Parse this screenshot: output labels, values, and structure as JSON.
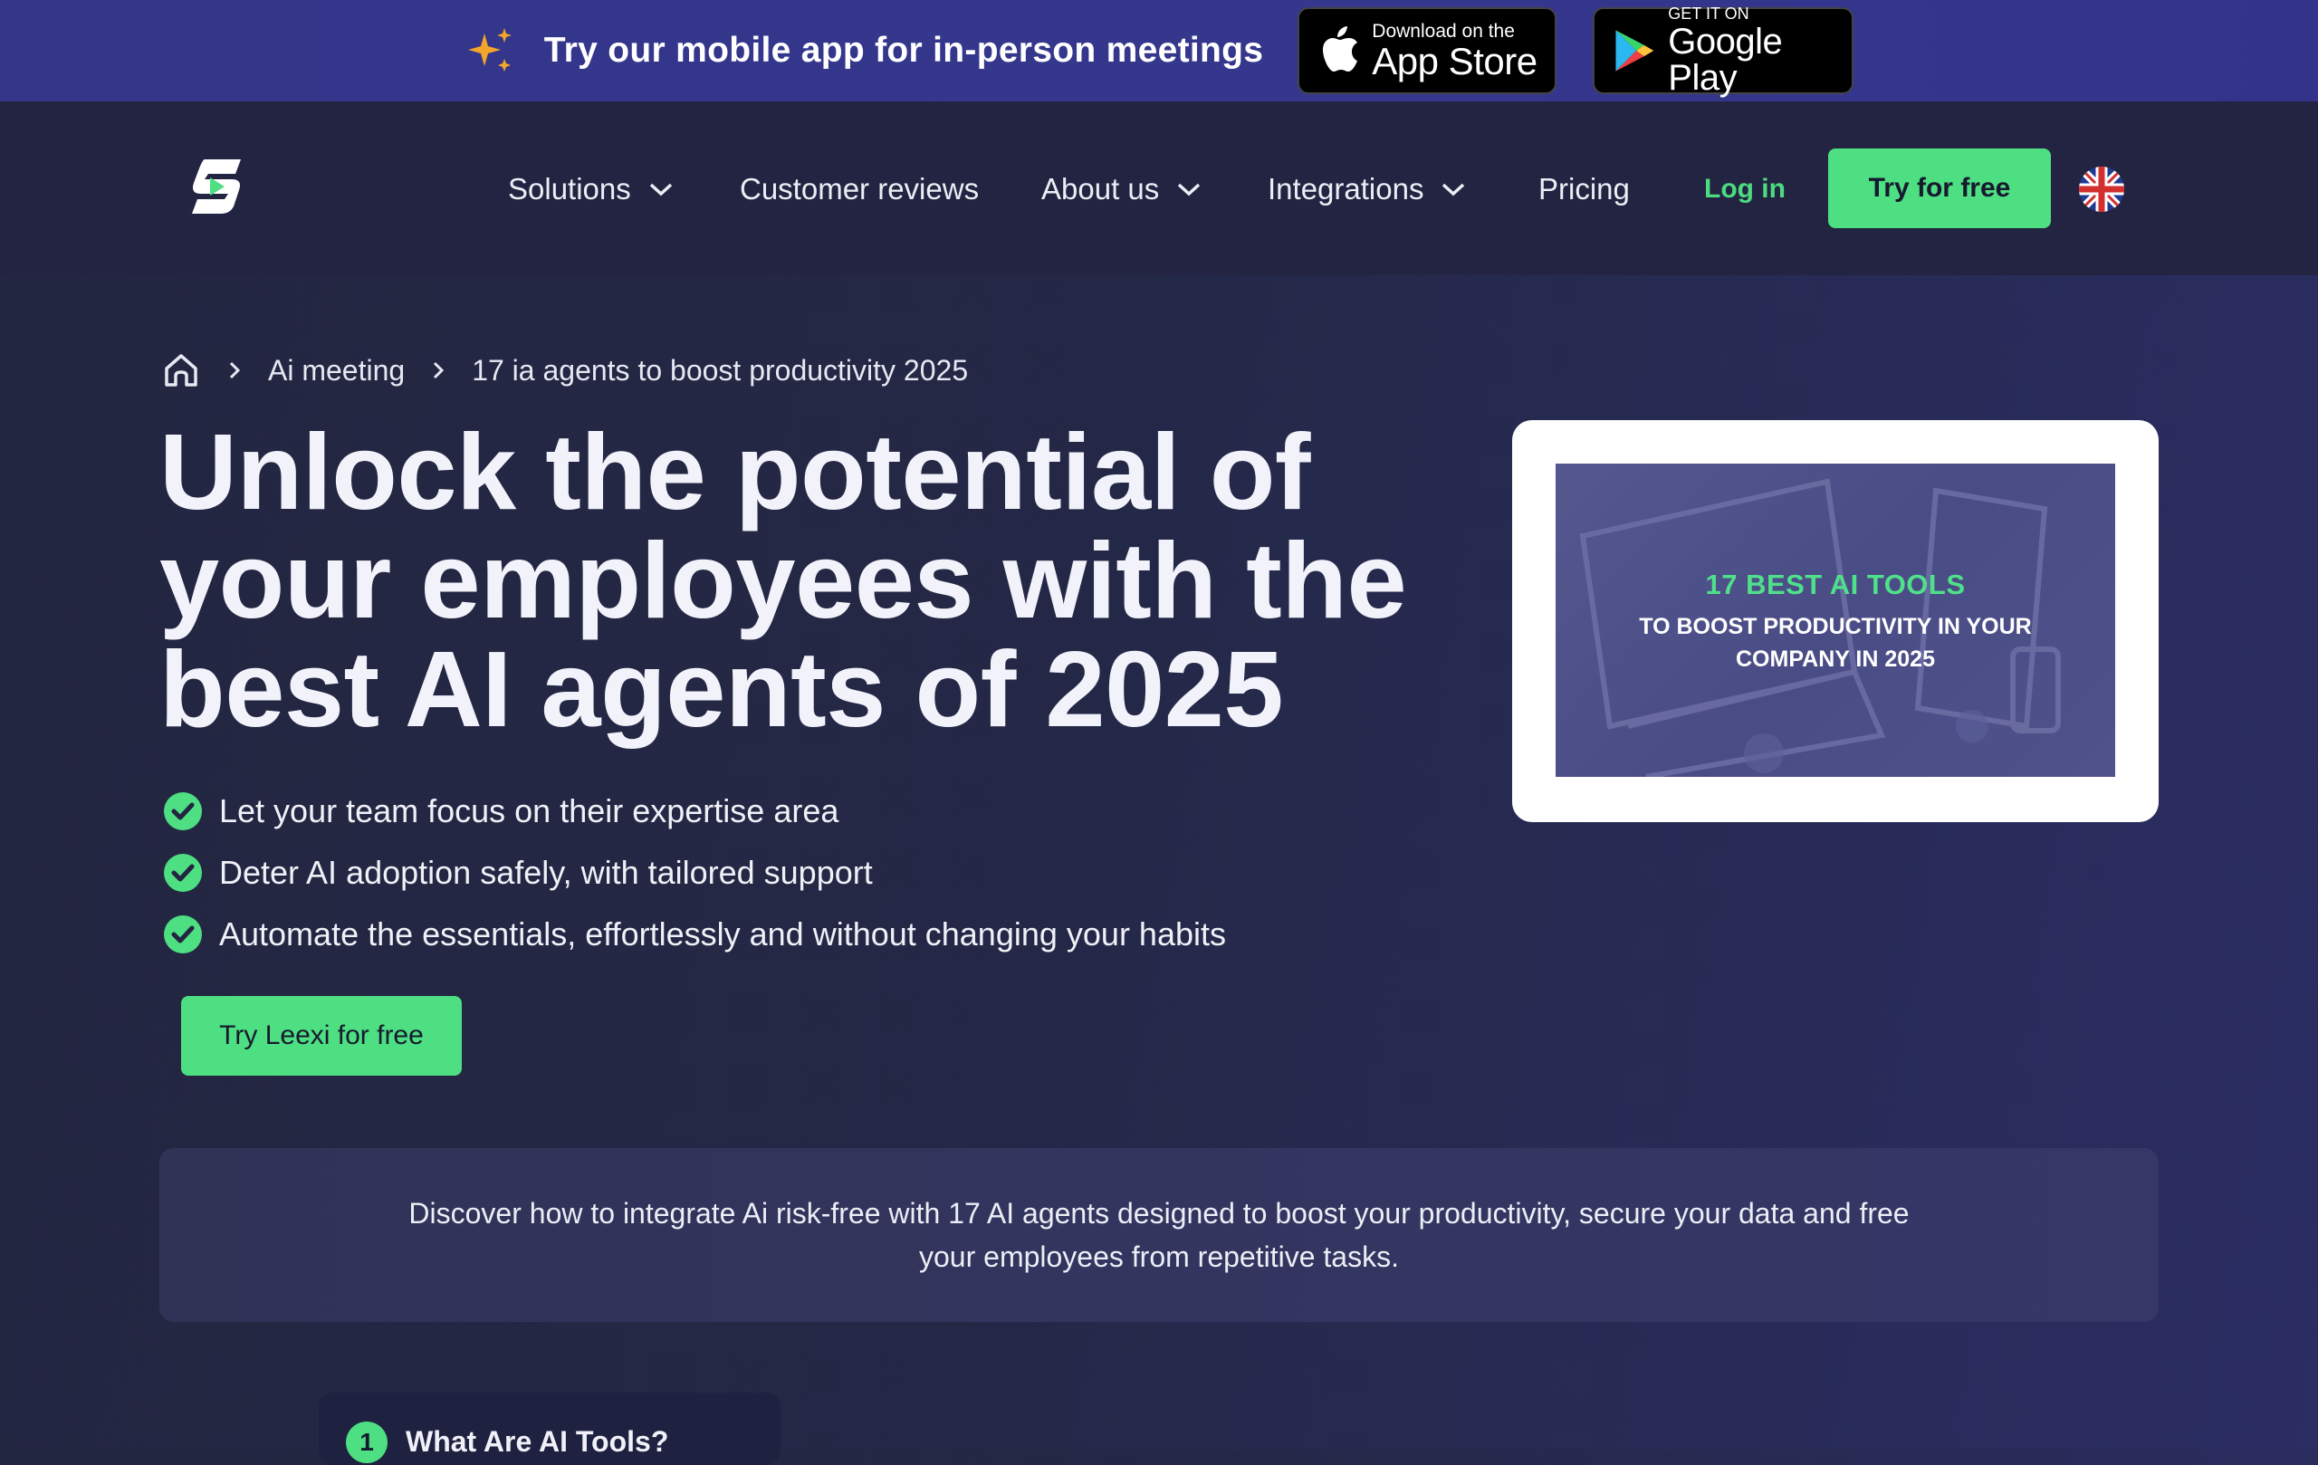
{
  "promo": {
    "text": "Try our mobile app for in-person meetings",
    "app_store": {
      "small": "Download on the",
      "big": "App Store"
    },
    "google_play": {
      "small": "GET IT ON",
      "big": "Google Play"
    },
    "accent_color": "#f4a62a"
  },
  "nav": {
    "items": [
      {
        "label": "Solutions",
        "has_dropdown": true
      },
      {
        "label": "Customer reviews",
        "has_dropdown": false
      },
      {
        "label": "About us",
        "has_dropdown": true
      },
      {
        "label": "Integrations",
        "has_dropdown": true
      },
      {
        "label": "Pricing",
        "has_dropdown": false
      }
    ],
    "login": "Log in",
    "cta": "Try for free",
    "language_icon": "uk-flag-icon"
  },
  "breadcrumb": {
    "items": [
      "Ai meeting",
      "17 ia agents to boost productivity 2025"
    ]
  },
  "hero": {
    "title": "Unlock the potential of your employees with the best AI agents of 2025",
    "bullets": [
      "Let your team focus on their expertise area",
      "Deter AI adoption safely, with tailored support",
      "Automate the essentials, effortlessly and without changing your habits"
    ],
    "cta": "Try Leexi for free"
  },
  "card": {
    "heading": "17 BEST AI TOOLS",
    "subheading": "TO BOOST PRODUCTIVITY IN YOUR COMPANY IN 2025"
  },
  "intro": {
    "text": "Discover how to integrate Ai risk-free with 17 AI agents designed to boost your productivity, secure your data and free your employees from repetitive tasks."
  },
  "toc": {
    "number": "1",
    "label": "What Are AI Tools?"
  },
  "colors": {
    "accent_green": "#4ddf82",
    "promo_bg": "#35378d",
    "nav_bg": "#232441",
    "page_bg": "#242846"
  }
}
